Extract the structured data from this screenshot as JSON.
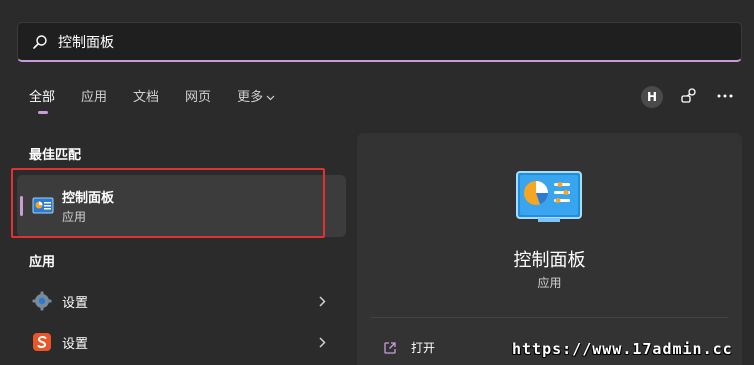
{
  "search": {
    "value": "控制面板"
  },
  "tabs": [
    {
      "label": "全部",
      "active": true
    },
    {
      "label": "应用"
    },
    {
      "label": "文档"
    },
    {
      "label": "网页"
    },
    {
      "label": "更多"
    }
  ],
  "header": {
    "avatar_letter": "H"
  },
  "best_match": {
    "title": "最佳匹配",
    "item": {
      "name": "控制面板",
      "kind": "应用"
    }
  },
  "apps": {
    "title": "应用",
    "items": [
      {
        "label": "设置",
        "icon": "gear-icon"
      },
      {
        "label": "设置",
        "icon": "sogou-icon"
      }
    ]
  },
  "detail": {
    "name": "控制面板",
    "kind": "应用",
    "actions": [
      {
        "label": "打开",
        "icon": "open-icon"
      }
    ]
  },
  "watermark": {
    "text": "https://www.17admin.cc"
  },
  "colors": {
    "accent": "#c99dd8",
    "highlight": "#e03232",
    "background": "#2b2b2b"
  }
}
